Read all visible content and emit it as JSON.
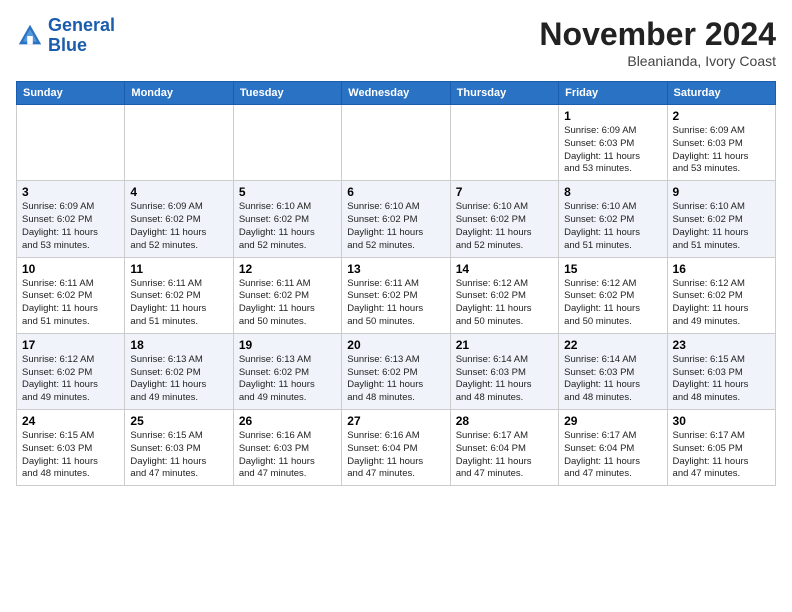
{
  "header": {
    "logo_line1": "General",
    "logo_line2": "Blue",
    "month_title": "November 2024",
    "location": "Bleanianda, Ivory Coast"
  },
  "days_of_week": [
    "Sunday",
    "Monday",
    "Tuesday",
    "Wednesday",
    "Thursday",
    "Friday",
    "Saturday"
  ],
  "weeks": [
    [
      {
        "day": "",
        "info": ""
      },
      {
        "day": "",
        "info": ""
      },
      {
        "day": "",
        "info": ""
      },
      {
        "day": "",
        "info": ""
      },
      {
        "day": "",
        "info": ""
      },
      {
        "day": "1",
        "info": "Sunrise: 6:09 AM\nSunset: 6:03 PM\nDaylight: 11 hours\nand 53 minutes."
      },
      {
        "day": "2",
        "info": "Sunrise: 6:09 AM\nSunset: 6:03 PM\nDaylight: 11 hours\nand 53 minutes."
      }
    ],
    [
      {
        "day": "3",
        "info": "Sunrise: 6:09 AM\nSunset: 6:02 PM\nDaylight: 11 hours\nand 53 minutes."
      },
      {
        "day": "4",
        "info": "Sunrise: 6:09 AM\nSunset: 6:02 PM\nDaylight: 11 hours\nand 52 minutes."
      },
      {
        "day": "5",
        "info": "Sunrise: 6:10 AM\nSunset: 6:02 PM\nDaylight: 11 hours\nand 52 minutes."
      },
      {
        "day": "6",
        "info": "Sunrise: 6:10 AM\nSunset: 6:02 PM\nDaylight: 11 hours\nand 52 minutes."
      },
      {
        "day": "7",
        "info": "Sunrise: 6:10 AM\nSunset: 6:02 PM\nDaylight: 11 hours\nand 52 minutes."
      },
      {
        "day": "8",
        "info": "Sunrise: 6:10 AM\nSunset: 6:02 PM\nDaylight: 11 hours\nand 51 minutes."
      },
      {
        "day": "9",
        "info": "Sunrise: 6:10 AM\nSunset: 6:02 PM\nDaylight: 11 hours\nand 51 minutes."
      }
    ],
    [
      {
        "day": "10",
        "info": "Sunrise: 6:11 AM\nSunset: 6:02 PM\nDaylight: 11 hours\nand 51 minutes."
      },
      {
        "day": "11",
        "info": "Sunrise: 6:11 AM\nSunset: 6:02 PM\nDaylight: 11 hours\nand 51 minutes."
      },
      {
        "day": "12",
        "info": "Sunrise: 6:11 AM\nSunset: 6:02 PM\nDaylight: 11 hours\nand 50 minutes."
      },
      {
        "day": "13",
        "info": "Sunrise: 6:11 AM\nSunset: 6:02 PM\nDaylight: 11 hours\nand 50 minutes."
      },
      {
        "day": "14",
        "info": "Sunrise: 6:12 AM\nSunset: 6:02 PM\nDaylight: 11 hours\nand 50 minutes."
      },
      {
        "day": "15",
        "info": "Sunrise: 6:12 AM\nSunset: 6:02 PM\nDaylight: 11 hours\nand 50 minutes."
      },
      {
        "day": "16",
        "info": "Sunrise: 6:12 AM\nSunset: 6:02 PM\nDaylight: 11 hours\nand 49 minutes."
      }
    ],
    [
      {
        "day": "17",
        "info": "Sunrise: 6:12 AM\nSunset: 6:02 PM\nDaylight: 11 hours\nand 49 minutes."
      },
      {
        "day": "18",
        "info": "Sunrise: 6:13 AM\nSunset: 6:02 PM\nDaylight: 11 hours\nand 49 minutes."
      },
      {
        "day": "19",
        "info": "Sunrise: 6:13 AM\nSunset: 6:02 PM\nDaylight: 11 hours\nand 49 minutes."
      },
      {
        "day": "20",
        "info": "Sunrise: 6:13 AM\nSunset: 6:02 PM\nDaylight: 11 hours\nand 48 minutes."
      },
      {
        "day": "21",
        "info": "Sunrise: 6:14 AM\nSunset: 6:03 PM\nDaylight: 11 hours\nand 48 minutes."
      },
      {
        "day": "22",
        "info": "Sunrise: 6:14 AM\nSunset: 6:03 PM\nDaylight: 11 hours\nand 48 minutes."
      },
      {
        "day": "23",
        "info": "Sunrise: 6:15 AM\nSunset: 6:03 PM\nDaylight: 11 hours\nand 48 minutes."
      }
    ],
    [
      {
        "day": "24",
        "info": "Sunrise: 6:15 AM\nSunset: 6:03 PM\nDaylight: 11 hours\nand 48 minutes."
      },
      {
        "day": "25",
        "info": "Sunrise: 6:15 AM\nSunset: 6:03 PM\nDaylight: 11 hours\nand 47 minutes."
      },
      {
        "day": "26",
        "info": "Sunrise: 6:16 AM\nSunset: 6:03 PM\nDaylight: 11 hours\nand 47 minutes."
      },
      {
        "day": "27",
        "info": "Sunrise: 6:16 AM\nSunset: 6:04 PM\nDaylight: 11 hours\nand 47 minutes."
      },
      {
        "day": "28",
        "info": "Sunrise: 6:17 AM\nSunset: 6:04 PM\nDaylight: 11 hours\nand 47 minutes."
      },
      {
        "day": "29",
        "info": "Sunrise: 6:17 AM\nSunset: 6:04 PM\nDaylight: 11 hours\nand 47 minutes."
      },
      {
        "day": "30",
        "info": "Sunrise: 6:17 AM\nSunset: 6:05 PM\nDaylight: 11 hours\nand 47 minutes."
      }
    ]
  ]
}
